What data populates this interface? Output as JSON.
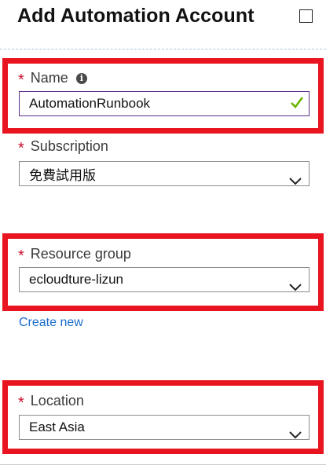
{
  "header": {
    "title": "Add Automation Account"
  },
  "form": {
    "name": {
      "label": "Name",
      "value": "AutomationRunbook"
    },
    "subscription": {
      "label": "Subscription",
      "value": "免費試用版"
    },
    "resource_group": {
      "label": "Resource group",
      "value": "ecloudture-lizun",
      "create_new": "Create new"
    },
    "location": {
      "label": "Location",
      "value": "East Asia"
    }
  },
  "required_marker": "*",
  "colors": {
    "highlight": "#e8141f",
    "required": "#c8102e",
    "link": "#1a6ccc",
    "valid_check": "#6bb700"
  },
  "icons": [
    "maximize-icon",
    "info-icon",
    "checkmark-icon",
    "chevron-down-icon"
  ]
}
